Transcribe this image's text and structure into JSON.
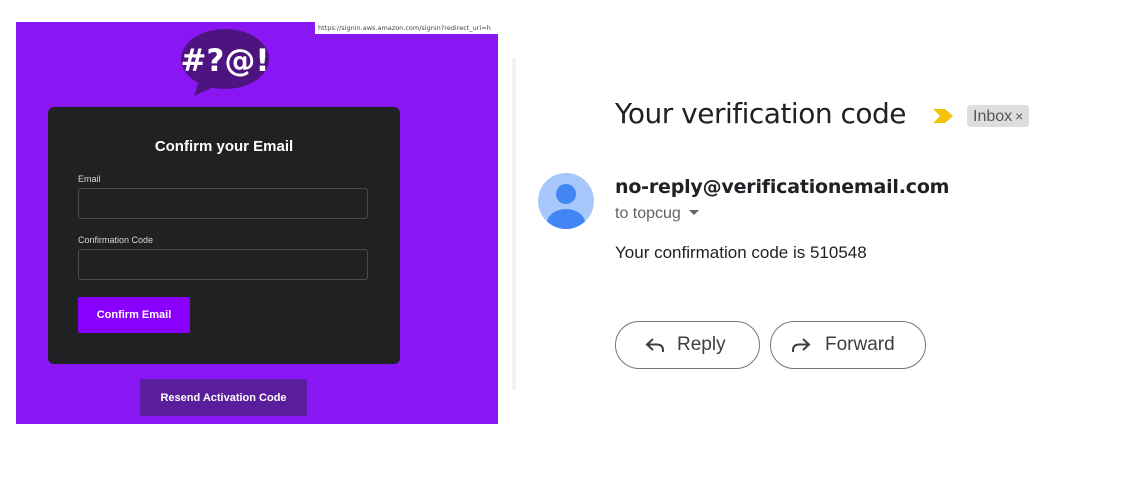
{
  "signin_page": {
    "url": "https://signin.aws.amazon.com/signin?redirect_uri=h",
    "logo_text": "#?@!",
    "card": {
      "title": "Confirm your Email",
      "email_label": "Email",
      "email_value": "",
      "code_label": "Confirmation Code",
      "code_value": "",
      "confirm_button": "Confirm Email"
    },
    "resend_button": "Resend Activation Code"
  },
  "email_view": {
    "subject": "Your verification code",
    "label": "Inbox",
    "label_close": "×",
    "sender": "no-reply@verificationemail.com",
    "recipient": "to topcug",
    "body": "Your confirmation code is 510548",
    "reply_button": "Reply",
    "forward_button": "Forward"
  },
  "colors": {
    "brand_purple": "#8a16f4",
    "button_purple": "#8a00ff",
    "resend_purple": "#5a1e9c",
    "card_dark": "#202123",
    "importance_yellow": "#f4c20d",
    "avatar_blue": "#4285f4",
    "avatar_bg": "#a8c7fa"
  },
  "icons": {
    "importance": "importance-marker-icon",
    "avatar": "default-avatar-icon",
    "reply": "reply-arrow-icon",
    "forward": "forward-arrow-icon",
    "dropdown": "caret-down-icon"
  }
}
